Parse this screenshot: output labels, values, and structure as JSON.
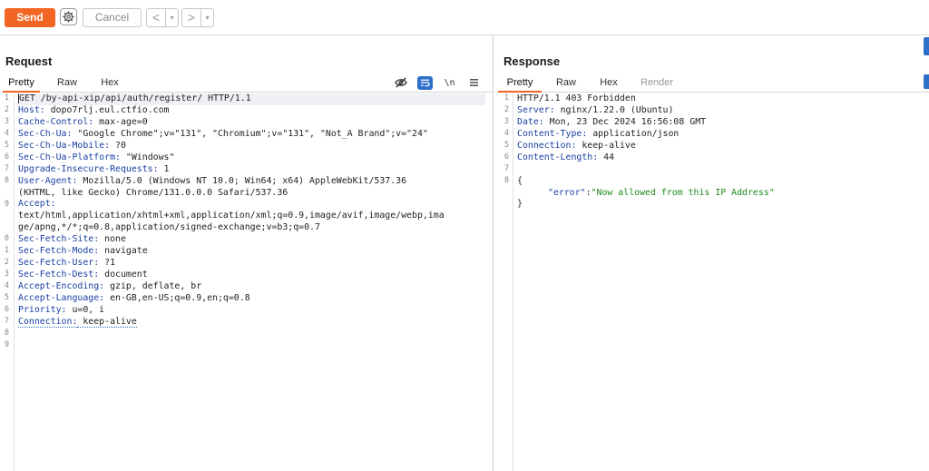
{
  "toolbar": {
    "send_label": "Send",
    "cancel_label": "Cancel",
    "prev_label": "<",
    "next_label": ">",
    "dropdown_label": "▾"
  },
  "request": {
    "title": "Request",
    "tabs": [
      "Pretty",
      "Raw",
      "Hex"
    ],
    "active_tab": "Pretty",
    "toolbar_icons": [
      "eye-slash-icon",
      "wrap-icon",
      "newline-icon",
      "menu-icon"
    ],
    "newline_label": "\\n",
    "line_numbers": [
      "1",
      "2",
      "3",
      "4",
      "5",
      "6",
      "7",
      "8",
      "",
      "9",
      "",
      "",
      "0",
      "1",
      "2",
      "3",
      "4",
      "5",
      "6",
      "7",
      "8",
      "9"
    ],
    "lines": [
      {
        "key": "",
        "val": "GET /by-api-xip/api/auth/register/ HTTP/1.1"
      },
      {
        "key": "Host:",
        "val": " dopo7rlj.eul.ctfio.com"
      },
      {
        "key": "Cache-Control:",
        "val": " max-age=0"
      },
      {
        "key": "Sec-Ch-Ua:",
        "val": " \"Google Chrome\";v=\"131\", \"Chromium\";v=\"131\", \"Not_A Brand\";v=\"24\""
      },
      {
        "key": "Sec-Ch-Ua-Mobile:",
        "val": " ?0"
      },
      {
        "key": "Sec-Ch-Ua-Platform:",
        "val": " \"Windows\""
      },
      {
        "key": "Upgrade-Insecure-Requests:",
        "val": " 1"
      },
      {
        "key": "User-Agent:",
        "val": " Mozilla/5.0 (Windows NT 10.0; Win64; x64) AppleWebKit/537.36"
      },
      {
        "key": "",
        "val": "(KHTML, like Gecko) Chrome/131.0.0.0 Safari/537.36"
      },
      {
        "key": "Accept:",
        "val": ""
      },
      {
        "key": "",
        "val": "text/html,application/xhtml+xml,application/xml;q=0.9,image/avif,image/webp,ima"
      },
      {
        "key": "",
        "val": "ge/apng,*/*;q=0.8,application/signed-exchange;v=b3;q=0.7"
      },
      {
        "key": "Sec-Fetch-Site:",
        "val": " none"
      },
      {
        "key": "Sec-Fetch-Mode:",
        "val": " navigate"
      },
      {
        "key": "Sec-Fetch-User:",
        "val": " ?1"
      },
      {
        "key": "Sec-Fetch-Dest:",
        "val": " document"
      },
      {
        "key": "Accept-Encoding:",
        "val": " gzip, deflate, br"
      },
      {
        "key": "Accept-Language:",
        "val": " en-GB,en-US;q=0.9,en;q=0.8"
      },
      {
        "key": "Priority:",
        "val": " u=0, i"
      },
      {
        "key": "Connection:",
        "val": " keep-alive"
      },
      {
        "key": "",
        "val": ""
      },
      {
        "key": "",
        "val": ""
      }
    ]
  },
  "response": {
    "title": "Response",
    "tabs": [
      "Pretty",
      "Raw",
      "Hex",
      "Render"
    ],
    "active_tab": "Pretty",
    "line_numbers": [
      "1",
      "2",
      "3",
      "4",
      "5",
      "6",
      "7",
      "8",
      "",
      ""
    ],
    "lines": [
      {
        "key": "",
        "val": "HTTP/1.1 403 Forbidden"
      },
      {
        "key": "Server:",
        "val": " nginx/1.22.0 (Ubuntu)"
      },
      {
        "key": "Date:",
        "val": " Mon, 23 Dec 2024 16:56:08 GMT"
      },
      {
        "key": "Content-Type:",
        "val": " application/json"
      },
      {
        "key": "Connection:",
        "val": " keep-alive"
      },
      {
        "key": "Content-Length:",
        "val": " 44"
      },
      {
        "key": "",
        "val": ""
      },
      {
        "key": "",
        "val": "{"
      },
      {
        "key": "",
        "val": "",
        "json_key": "\"error\"",
        "json_sep": ":",
        "json_val": "\"Now allowed from this IP Address\""
      },
      {
        "key": "",
        "val": "}"
      }
    ]
  },
  "colors": {
    "accent": "#f26522",
    "header_key": "#1a3fa3",
    "json_string": "#1e8a1e",
    "wrap_active": "#2d6fc9"
  }
}
